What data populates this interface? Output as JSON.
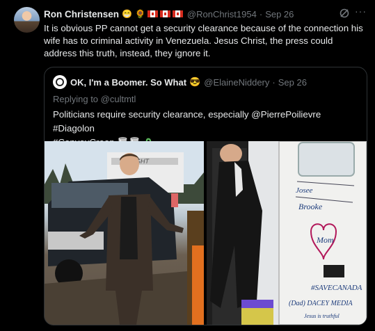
{
  "post": {
    "author_name": "Ron Christensen",
    "author_emojis": [
      "😁",
      "🌻"
    ],
    "flag_count": 3,
    "handle": "@RonChrist1954",
    "separator": "·",
    "date": "Sep 26",
    "more_label": "···",
    "text": "It is obvious PP cannot get a security clearance because of the connection his wife has to criminal activity in Venezuela.  Jesus Christ, the press could address this truth, instead, they ignore it."
  },
  "quoted": {
    "author_name": "OK, I'm a Boomer. So What",
    "author_emoji": "😎",
    "handle": "@ElaineNiddery",
    "separator": "·",
    "date": "Sep 26",
    "replying_prefix": "Replying to ",
    "replying_to": "@cultmtl",
    "text_line1": "Politicians require security clearance, especially @PierrePoilievre #Diagolon",
    "text_line2": "#ConvoyCreep 🥃🥃",
    "sign_texts": [
      "FLIGHT",
      "Josee",
      "Brooke",
      "Mom",
      "#SAVECANADA",
      "(Dad) DACEY MEDIA",
      "Jesus is truthful"
    ]
  }
}
